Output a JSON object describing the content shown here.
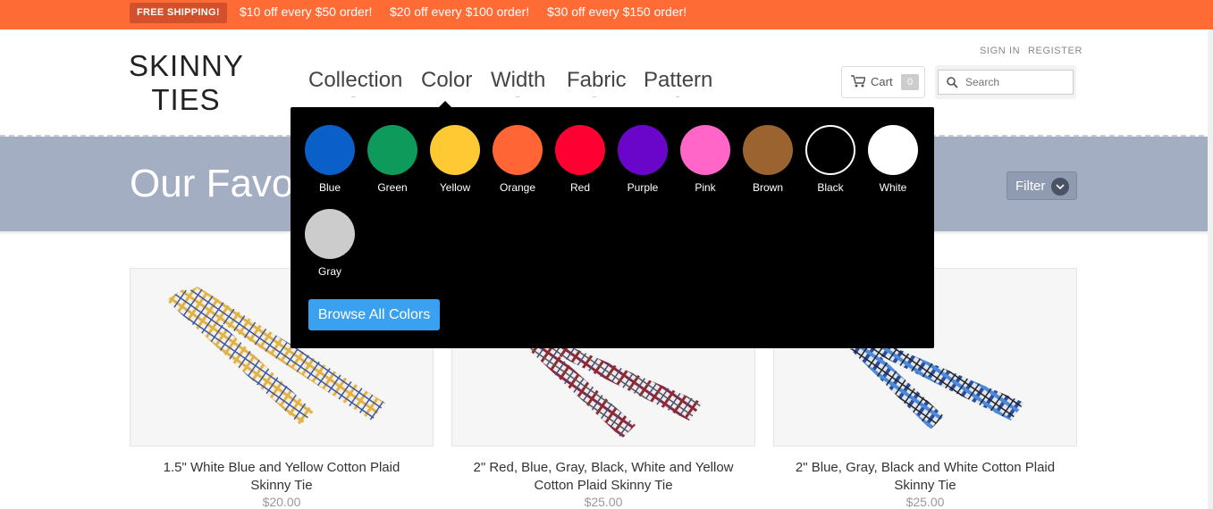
{
  "promo": {
    "badge": "FREE SHIPPING!",
    "offers": [
      "$10 off every $50 order!",
      "$20 off every $100 order!",
      "$30 off every $150 order!"
    ]
  },
  "logo": {
    "line1": "SKINNY",
    "line2": "TIES"
  },
  "nav": {
    "items": [
      "Collection",
      "Color",
      "Width",
      "Fabric",
      "Pattern"
    ]
  },
  "account": {
    "sign_in": "SIGN IN",
    "register": "REGISTER"
  },
  "cart": {
    "label": "Cart",
    "count": "0"
  },
  "search": {
    "placeholder": "Search"
  },
  "hero": {
    "title": "Our Favorites",
    "filter_label": "Filter"
  },
  "color_menu": {
    "swatches": [
      {
        "label": "Blue",
        "color": "#0a5fc9"
      },
      {
        "label": "Green",
        "color": "#0d9a5a"
      },
      {
        "label": "Yellow",
        "color": "#ffc933"
      },
      {
        "label": "Orange",
        "color": "#ff6535"
      },
      {
        "label": "Red",
        "color": "#ff0033"
      },
      {
        "label": "Purple",
        "color": "#6a06c9"
      },
      {
        "label": "Pink",
        "color": "#ff66c8"
      },
      {
        "label": "Brown",
        "color": "#9a6330"
      },
      {
        "label": "Black",
        "color": "#000000"
      },
      {
        "label": "White",
        "color": "#ffffff"
      },
      {
        "label": "Gray",
        "color": "#cccccc"
      }
    ],
    "browse_label": "Browse All Colors"
  },
  "products": [
    {
      "name": "1.5\" White Blue and Yellow Cotton Plaid Skinny Tie",
      "price": "$20.00"
    },
    {
      "name": "2\" Red, Blue, Gray, Black, White and Yellow Cotton Plaid Skinny Tie",
      "price": "$25.00"
    },
    {
      "name": "2\" Blue, Gray, Black and White Cotton Plaid Skinny Tie",
      "price": "$25.00"
    }
  ],
  "colors": {
    "promo_bg": "#ff6b35",
    "hero_bg": "#a3aec2",
    "dropdown_bg": "#000000",
    "button_blue": "#3aa0f0"
  }
}
